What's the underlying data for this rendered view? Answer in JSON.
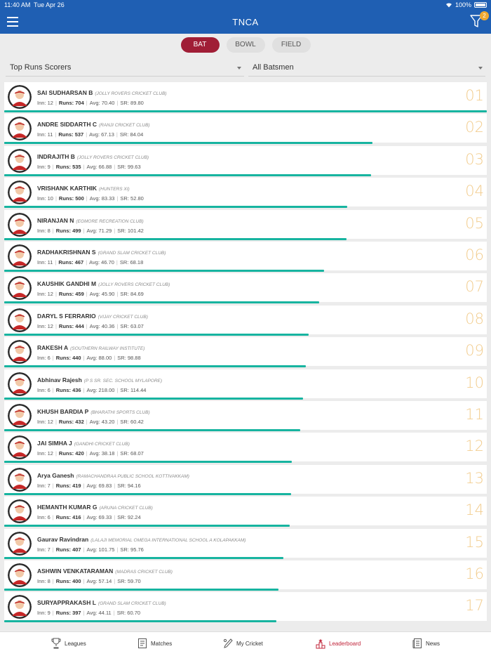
{
  "status_bar": {
    "time": "11:40 AM",
    "date": "Tue Apr 26",
    "battery": "100%"
  },
  "header": {
    "title": "TNCA",
    "filter_badge": "2"
  },
  "toggles": [
    {
      "label": "BAT",
      "active": true
    },
    {
      "label": "BOWL",
      "active": false
    },
    {
      "label": "FIELD",
      "active": false
    }
  ],
  "filters": {
    "category": "Top Runs Scorers",
    "scope": "All Batsmen"
  },
  "stat_labels": {
    "inn": "Inn:",
    "runs": "Runs:",
    "avg": "Avg:",
    "sr": "SR:"
  },
  "players": [
    {
      "name": "SAI SUDHARSAN B",
      "club": "(JOLLY ROVERS CRICKET CLUB)",
      "inn": "12",
      "runs": "704",
      "avg": "70.40",
      "sr": "89.80",
      "rank": "01"
    },
    {
      "name": "ANDRE SIDDARTH C",
      "club": "(RANJI CRICKET CLUB)",
      "inn": "11",
      "runs": "537",
      "avg": "67.13",
      "sr": "84.04",
      "rank": "02"
    },
    {
      "name": "INDRAJITH B",
      "club": "(JOLLY ROVERS CRICKET CLUB)",
      "inn": "9",
      "runs": "535",
      "avg": "66.88",
      "sr": "99.63",
      "rank": "03"
    },
    {
      "name": "VRISHANK KARTHIK",
      "club": "(HUNTERS XI)",
      "inn": "10",
      "runs": "500",
      "avg": "83.33",
      "sr": "52.80",
      "rank": "04"
    },
    {
      "name": "NIRANJAN N",
      "club": "(EGMORE RECREATION CLUB)",
      "inn": "8",
      "runs": "499",
      "avg": "71.29",
      "sr": "101.42",
      "rank": "05"
    },
    {
      "name": "RADHAKRISHNAN S",
      "club": "(GRAND SLAM CRICKET CLUB)",
      "inn": "11",
      "runs": "467",
      "avg": "46.70",
      "sr": "68.18",
      "rank": "06"
    },
    {
      "name": "KAUSHIK GANDHI M",
      "club": "(JOLLY ROVERS CRICKET CLUB)",
      "inn": "12",
      "runs": "459",
      "avg": "45.90",
      "sr": "84.69",
      "rank": "07"
    },
    {
      "name": "DARYL S FERRARIO",
      "club": "(VIJAY CRICKET CLUB)",
      "inn": "12",
      "runs": "444",
      "avg": "40.36",
      "sr": "63.07",
      "rank": "08"
    },
    {
      "name": "RAKESH A",
      "club": "(SOUTHERN RAILWAY INSTITUTE)",
      "inn": "6",
      "runs": "440",
      "avg": "88.00",
      "sr": "98.88",
      "rank": "09"
    },
    {
      "name": "Abhinav Rajesh",
      "club": "(P S SR. SEC. SCHOOL MYLAPORE)",
      "inn": "6",
      "runs": "436",
      "avg": "218.00",
      "sr": "114.44",
      "rank": "10"
    },
    {
      "name": "KHUSH BARDIA P",
      "club": "(BHARATHI SPORTS CLUB)",
      "inn": "12",
      "runs": "432",
      "avg": "43.20",
      "sr": "60.42",
      "rank": "11"
    },
    {
      "name": "JAI SIMHA J",
      "club": "(GANDHI CRICKET CLUB)",
      "inn": "12",
      "runs": "420",
      "avg": "38.18",
      "sr": "68.07",
      "rank": "12"
    },
    {
      "name": "Arya Ganesh",
      "club": "(RAMACHANDRAA PUBLIC SCHOOL KOTTIVAKKAM)",
      "inn": "7",
      "runs": "419",
      "avg": "69.83",
      "sr": "94.16",
      "rank": "13"
    },
    {
      "name": "HEMANTH KUMAR G",
      "club": "(ARUNA CRICKET CLUB)",
      "inn": "6",
      "runs": "416",
      "avg": "69.33",
      "sr": "92.24",
      "rank": "14"
    },
    {
      "name": "Gaurav Ravindran",
      "club": "(LALAJI MEMORIAL OMEGA INTERNATIONAL SCHOOL A KOLAPAKKAM)",
      "inn": "7",
      "runs": "407",
      "avg": "101.75",
      "sr": "95.76",
      "rank": "15"
    },
    {
      "name": "ASHWIN VENKATARAMAN",
      "club": "(MADRAS CRICKET CLUB)",
      "inn": "8",
      "runs": "400",
      "avg": "57.14",
      "sr": "59.70",
      "rank": "16"
    },
    {
      "name": "SURYAPPRAKASH L",
      "club": "(GRAND SLAM CRICKET CLUB)",
      "inn": "9",
      "runs": "397",
      "avg": "44.11",
      "sr": "60.70",
      "rank": "17"
    }
  ],
  "tabs": [
    {
      "label": "Leagues",
      "icon": "trophy-icon",
      "active": false
    },
    {
      "label": "Matches",
      "icon": "scorecard-icon",
      "active": false
    },
    {
      "label": "My Cricket",
      "icon": "bat-ball-icon",
      "active": false
    },
    {
      "label": "Leaderboard",
      "icon": "podium-icon",
      "active": true
    },
    {
      "label": "News",
      "icon": "newspaper-icon",
      "active": false
    }
  ],
  "colors": {
    "header": "#1f5fb3",
    "active_toggle": "#a01e36",
    "bar": "#17b4a0",
    "rank": "#f2cd8f",
    "active_tab": "#c0243a"
  }
}
